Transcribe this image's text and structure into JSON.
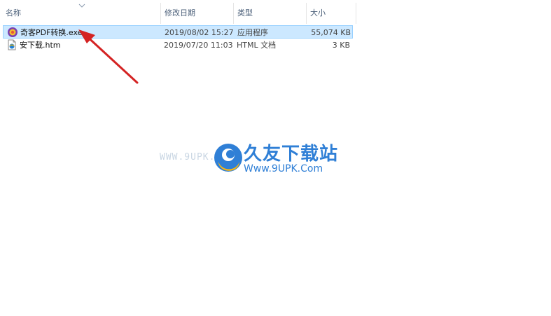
{
  "columns": {
    "name": "名称",
    "modified": "修改日期",
    "type": "类型",
    "size": "大小"
  },
  "files": [
    {
      "name": "奇客PDF转换.exe",
      "modified": "2019/08/02 15:27",
      "type": "应用程序",
      "size": "55,074 KB",
      "icon": "app-exe-icon",
      "selected": true
    },
    {
      "name": "安下载.htm",
      "modified": "2019/07/20 11:03",
      "type": "HTML 文档",
      "size": "3 KB",
      "icon": "html-document-icon",
      "selected": false
    }
  ],
  "watermark": {
    "url_faded": "WWW.9UPK.COM",
    "title": "久友下载站",
    "url": "Www.9UPK.Com"
  },
  "colors": {
    "selection_bg": "#cce8ff",
    "selection_border": "#99d1ff",
    "header_text": "#4c607a",
    "annotation_arrow": "#d42323",
    "watermark_blue": "#2f7fd6"
  }
}
